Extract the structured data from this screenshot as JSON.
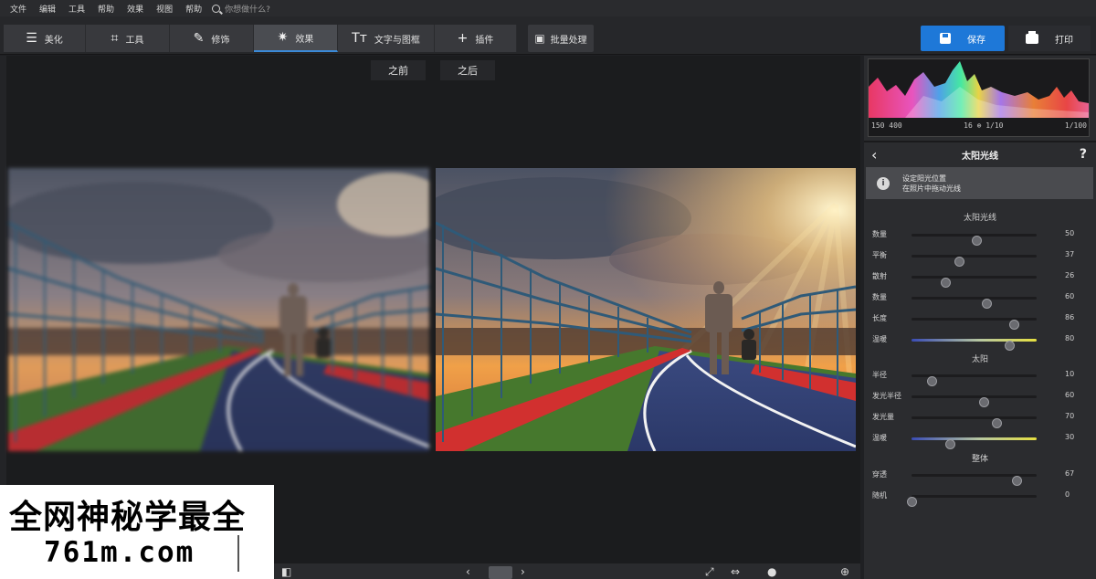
{
  "menu": {
    "items": [
      "文件",
      "编辑",
      "工具",
      "帮助",
      "效果",
      "视图",
      "帮助"
    ],
    "search_placeholder": "你想做什么?"
  },
  "toolbar": {
    "tabs": [
      {
        "label": "美化",
        "icon": "sliders-icon"
      },
      {
        "label": "工具",
        "icon": "crop-icon"
      },
      {
        "label": "修饰",
        "icon": "brush-icon"
      },
      {
        "label": "效果",
        "icon": "magic-wand-icon",
        "active": true
      },
      {
        "label": "文字与图框",
        "icon": "text-icon"
      },
      {
        "label": "插件",
        "icon": "plus-icon"
      }
    ],
    "batch_label": "批量处理",
    "save_label": "保存",
    "print_label": "打印"
  },
  "compare": {
    "before_label": "之前",
    "after_label": "之后"
  },
  "histogram": {
    "labels": [
      "150 400",
      "16 ⊕ 1/10",
      "1/100"
    ]
  },
  "panel": {
    "title": "太阳光线",
    "info_line1": "设定阳光位置",
    "info_line2": "在照片中拖动光线",
    "sections": [
      {
        "title": "太阳光线",
        "rows": [
          {
            "label": "数量",
            "value": "50",
            "level": 0.52
          },
          {
            "label": "平衡",
            "value": "37",
            "level": 0.38
          },
          {
            "label": "散射",
            "value": "26",
            "level": 0.27
          },
          {
            "label": "数量",
            "value": "60",
            "level": 0.6
          },
          {
            "label": "长度",
            "value": "86",
            "level": 0.82
          },
          {
            "label": "温暖",
            "value": "80",
            "level": 0.78,
            "gradient": true
          }
        ]
      },
      {
        "title": "太阳",
        "rows": [
          {
            "label": "半径",
            "value": "10",
            "level": 0.16
          },
          {
            "label": "发光半径",
            "value": "60",
            "level": 0.58
          },
          {
            "label": "发光量",
            "value": "70",
            "level": 0.68
          },
          {
            "label": "温暖",
            "value": "30",
            "level": 0.31,
            "gradient": true
          }
        ]
      },
      {
        "title": "整体",
        "rows": [
          {
            "label": "穿透",
            "value": "67",
            "level": 0.84
          },
          {
            "label": "随机",
            "value": "0",
            "level": 0.0
          }
        ]
      }
    ]
  },
  "watermark": {
    "line1": "全网神秘学最全",
    "line2": "761m.com"
  },
  "colors": {
    "accent": "#1e78d8",
    "panel": "#2b2c2f",
    "canvas": "#1b1c1e"
  }
}
